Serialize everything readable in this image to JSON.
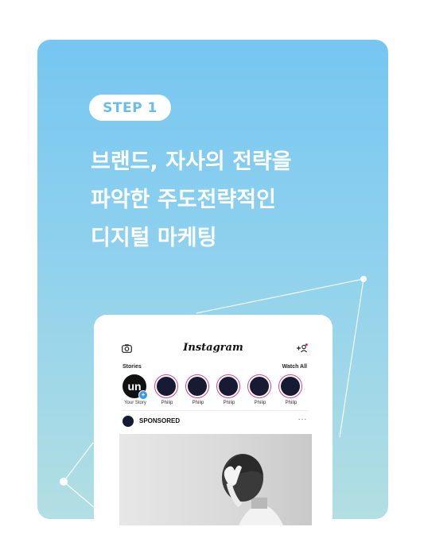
{
  "step": {
    "label": "STEP 1"
  },
  "headline": {
    "lines": [
      "브랜드, 자사의 전략을",
      "파악한 주도전략적인",
      "디지털 마케팅"
    ]
  },
  "instagram": {
    "logo": "Instagram",
    "stories_label": "Stories",
    "watch_all": "Watch All",
    "own_story": {
      "initials": "un",
      "name": "Your Story"
    },
    "stories": [
      {
        "name": "Philip"
      },
      {
        "name": "Philip"
      },
      {
        "name": "Philip"
      },
      {
        "name": "Philip"
      },
      {
        "name": "Philip"
      }
    ],
    "post": {
      "label": "SPONSORED",
      "more": "···"
    }
  },
  "colors": {
    "gradient_top": "#76c6f1",
    "gradient_bottom": "#b2dfe2",
    "step_text": "#6bbde9",
    "story_ring": "#d6428a",
    "story_fill": "#161a33"
  },
  "icons": [
    "camera-icon",
    "add-user-icon",
    "more-icon"
  ]
}
